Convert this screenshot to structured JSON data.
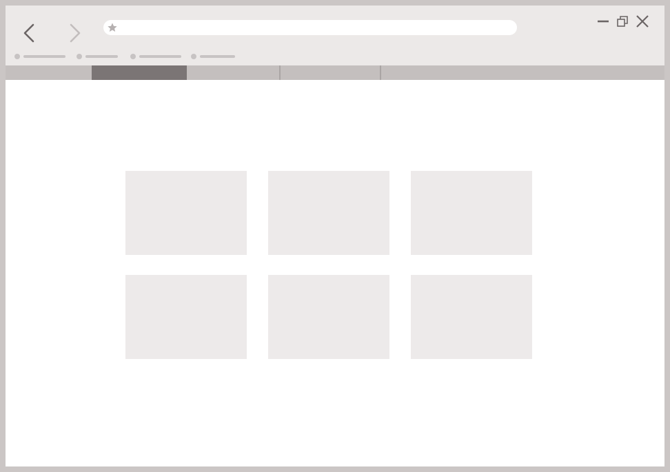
{
  "window": {
    "icons": {
      "back": "chevron-left-icon",
      "forward": "chevron-right-icon",
      "minimize": "minimize-icon",
      "restore": "restore-icon",
      "close": "close-icon",
      "bookmark_star": "star-icon"
    }
  },
  "address_bar": {
    "value": "",
    "placeholder": ""
  },
  "bookmarks": [
    {
      "label": ""
    },
    {
      "label": ""
    },
    {
      "label": ""
    },
    {
      "label": ""
    }
  ],
  "tabs": [
    {
      "label": "",
      "active": false
    },
    {
      "label": "",
      "active": true
    },
    {
      "label": "",
      "active": false
    },
    {
      "label": "",
      "active": false
    },
    {
      "label": "",
      "active": false
    }
  ],
  "speed_dial": {
    "tiles": [
      {
        "label": ""
      },
      {
        "label": ""
      },
      {
        "label": ""
      },
      {
        "label": ""
      },
      {
        "label": ""
      },
      {
        "label": ""
      }
    ]
  },
  "colors": {
    "frame": "#cbc6c5",
    "titlebar": "#ece9e8",
    "tabstrip": "#c4bfbe",
    "active_tab": "#7b7575",
    "tile": "#edeaea",
    "icon": "#6b6565",
    "icon_disabled": "#c2bdbd"
  }
}
